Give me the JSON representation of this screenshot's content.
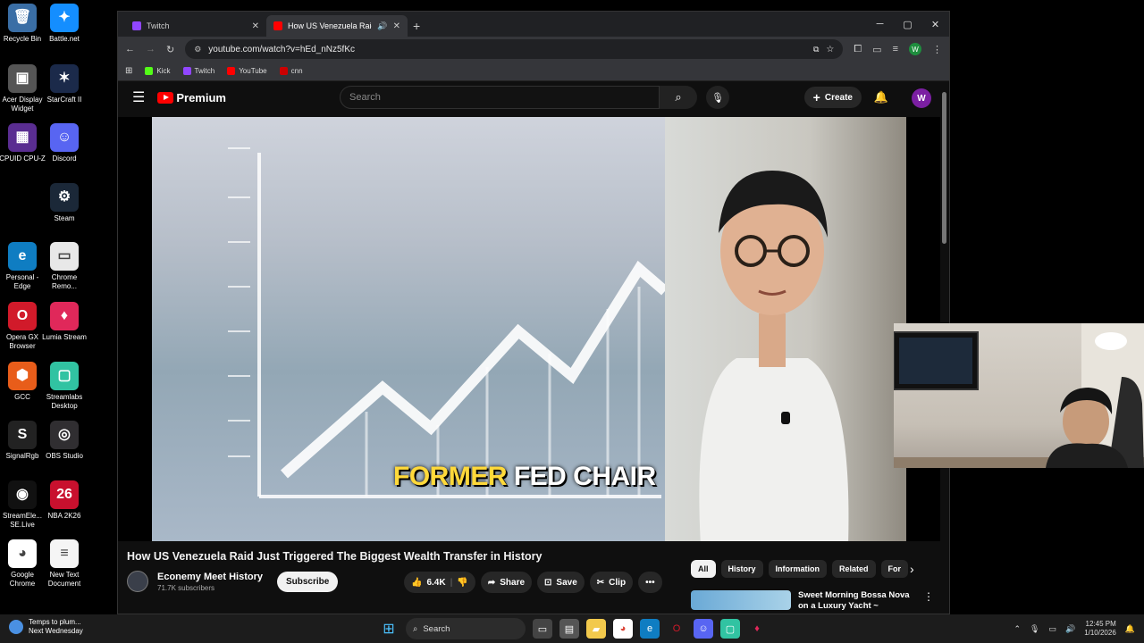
{
  "desktop": {
    "icons": [
      {
        "label": "Recycle Bin",
        "color": "#3a6ea5",
        "glyph": "🗑"
      },
      {
        "label": "Battle.net",
        "color": "#148eff",
        "glyph": "✦"
      },
      {
        "label": "Acer Display Widget",
        "color": "#555555",
        "glyph": "▣"
      },
      {
        "label": "StarCraft II",
        "color": "#1b2a4a",
        "glyph": "✶"
      },
      {
        "label": "CPUID CPU-Z",
        "color": "#5a2d91",
        "glyph": "▦"
      },
      {
        "label": "Discord",
        "color": "#5865f2",
        "glyph": "☺"
      },
      {
        "label": "Steam",
        "color": "#1b2838",
        "glyph": "⚙"
      },
      {
        "label": "Personal - Edge",
        "color": "#0f7dc2",
        "glyph": "e"
      },
      {
        "label": "Chrome Remo...",
        "color": "#e8e8e8",
        "glyph": "▭"
      },
      {
        "label": "Opera GX Browser",
        "color": "#d11a2a",
        "glyph": "O"
      },
      {
        "label": "Lumia Stream",
        "color": "#e0285a",
        "glyph": "♦"
      },
      {
        "label": "GCC",
        "color": "#e85d1a",
        "glyph": "⬢"
      },
      {
        "label": "Streamlabs Desktop",
        "color": "#31c3a2",
        "glyph": "▢"
      },
      {
        "label": "SignalRgb",
        "color": "#222222",
        "glyph": "S"
      },
      {
        "label": "OBS Studio",
        "color": "#302e31",
        "glyph": "◎"
      },
      {
        "label": "StreamEle... SE.Live",
        "color": "#111111",
        "glyph": "◉"
      },
      {
        "label": "NBA 2K26",
        "color": "#c8102e",
        "glyph": "26"
      },
      {
        "label": "Google Chrome",
        "color": "#ffffff",
        "glyph": "◕"
      },
      {
        "label": "New Text Document",
        "color": "#f5f5f5",
        "glyph": "≡"
      }
    ]
  },
  "browser": {
    "tabs": [
      {
        "title": "Twitch",
        "favicon_color": "#9146ff"
      },
      {
        "title": "How US Venezuela Raid Just",
        "favicon_color": "#ff0000"
      }
    ],
    "new_tab": "+",
    "url": "youtube.com/watch?v=hEd_nNz5fKc",
    "profile_initial": "W",
    "bookmarks": [
      {
        "label": "Kick",
        "color": "#53fc18"
      },
      {
        "label": "Twitch",
        "color": "#9146ff"
      },
      {
        "label": "YouTube",
        "color": "#ff0000"
      },
      {
        "label": "cnn",
        "color": "#cc0000"
      }
    ]
  },
  "youtube": {
    "logo_text": "Premium",
    "search_placeholder": "Search",
    "create_label": "Create",
    "avatar_initial": "W",
    "caption_word1": "FORMER",
    "caption_rest": "FED CHAIR",
    "video_title": "How US Venezuela Raid Just Triggered The Biggest Wealth Transfer in History",
    "channel_name": "Econemy Meet History",
    "channel_subs": "71.7K subscribers",
    "subscribe_label": "Subscribe",
    "like_count": "6.4K",
    "share_label": "Share",
    "save_label": "Save",
    "clip_label": "Clip",
    "more_label": "•••",
    "chips": [
      "All",
      "History",
      "Information",
      "Related",
      "For"
    ],
    "recommendation_title": "Sweet Morning Bossa Nova on a Luxury Yacht ~ Relaxing Jaz"
  },
  "taskbar": {
    "weather_line1": "Temps to plum...",
    "weather_line2": "Next Wednesday",
    "search_label": "Search",
    "time": "12:45 PM",
    "date": "1/10/2026"
  }
}
